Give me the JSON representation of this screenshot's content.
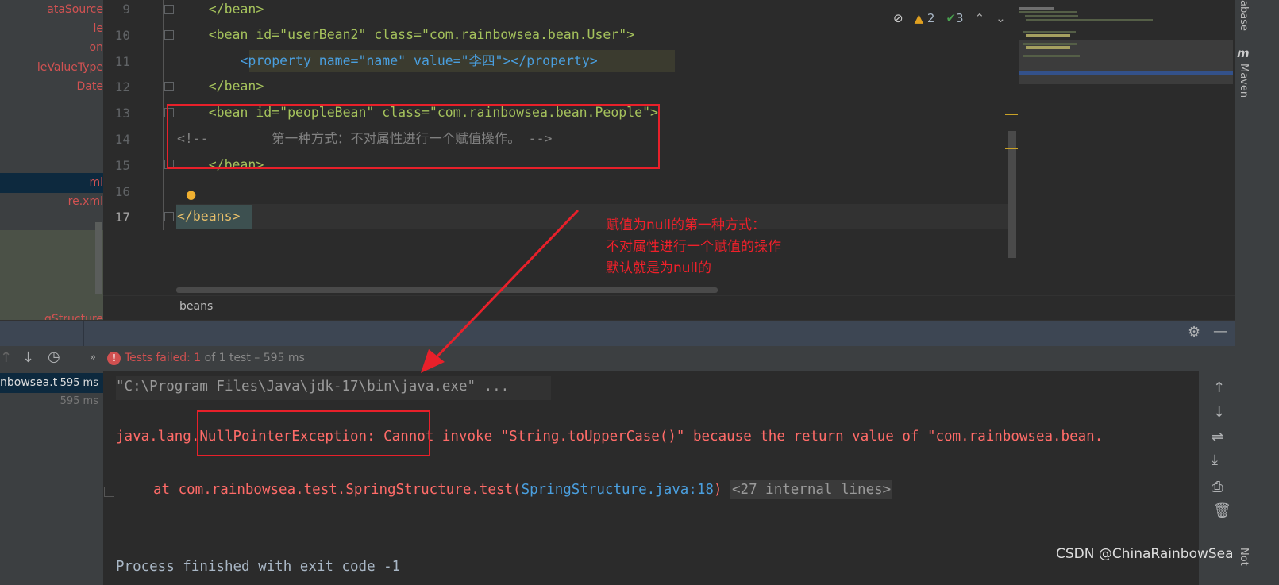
{
  "project_tree": {
    "items": [
      {
        "label": "ataSource",
        "selected": false
      },
      {
        "label": "le",
        "selected": false
      },
      {
        "label": "on",
        "selected": false
      },
      {
        "label": "leValueType",
        "selected": false
      },
      {
        "label": "Date",
        "selected": false
      },
      {
        "label": "ml",
        "selected": true
      },
      {
        "label": "re.xml",
        "selected": false
      },
      {
        "label": "gStructure",
        "selected": false
      }
    ]
  },
  "editor": {
    "line_numbers": [
      "9",
      "10",
      "11",
      "12",
      "13",
      "14",
      "15",
      "16",
      "17"
    ],
    "lines": [
      "    </bean>",
      "    <bean id=\"userBean2\" class=\"com.rainbowsea.bean.User\">",
      "        <property name=\"name\" value=\"李四\"></property>",
      "    </bean>",
      "    <bean id=\"peopleBean\" class=\"com.rainbowsea.bean.People\">",
      "<!--        第一种方式：不对属性进行一个赋值操作。 -->",
      "    </bean>",
      "",
      "</beans>"
    ],
    "inspections": {
      "warnings": "2",
      "ok": "3"
    },
    "breadcrumb": "beans"
  },
  "annotation": {
    "lines": [
      "赋值为null的第一种方式：",
      "不对属性进行一个赋值的操作",
      "默认就是为null的"
    ],
    "color": "#f0202a"
  },
  "right_stripe": {
    "database": "abase",
    "maven": "Maven",
    "notifications": "Not"
  },
  "run": {
    "status_label": "Tests failed:",
    "failed": "1",
    "status_rest": "of 1 test – 595 ms",
    "tree": [
      {
        "label": "nbowsea.te",
        "time": "595 ms"
      },
      {
        "label": "",
        "time": "595 ms"
      }
    ],
    "console": {
      "cmd": "\"C:\\Program Files\\Java\\jdk-17\\bin\\java.exe\" ...",
      "exception": "java.lang.NullPointerException: Cannot invoke \"String.toUpperCase()\" because the return value of \"com.rainbowsea.bean.",
      "at_prefix": "at com.rainbowsea.test.SpringStructure.test(",
      "at_link": "SpringStructure.java:18",
      "at_suffix": ")",
      "internal": "<27 internal lines>",
      "exit": "Process finished with exit code -1"
    }
  },
  "watermark": "CSDN @ChinaRainbowSea"
}
